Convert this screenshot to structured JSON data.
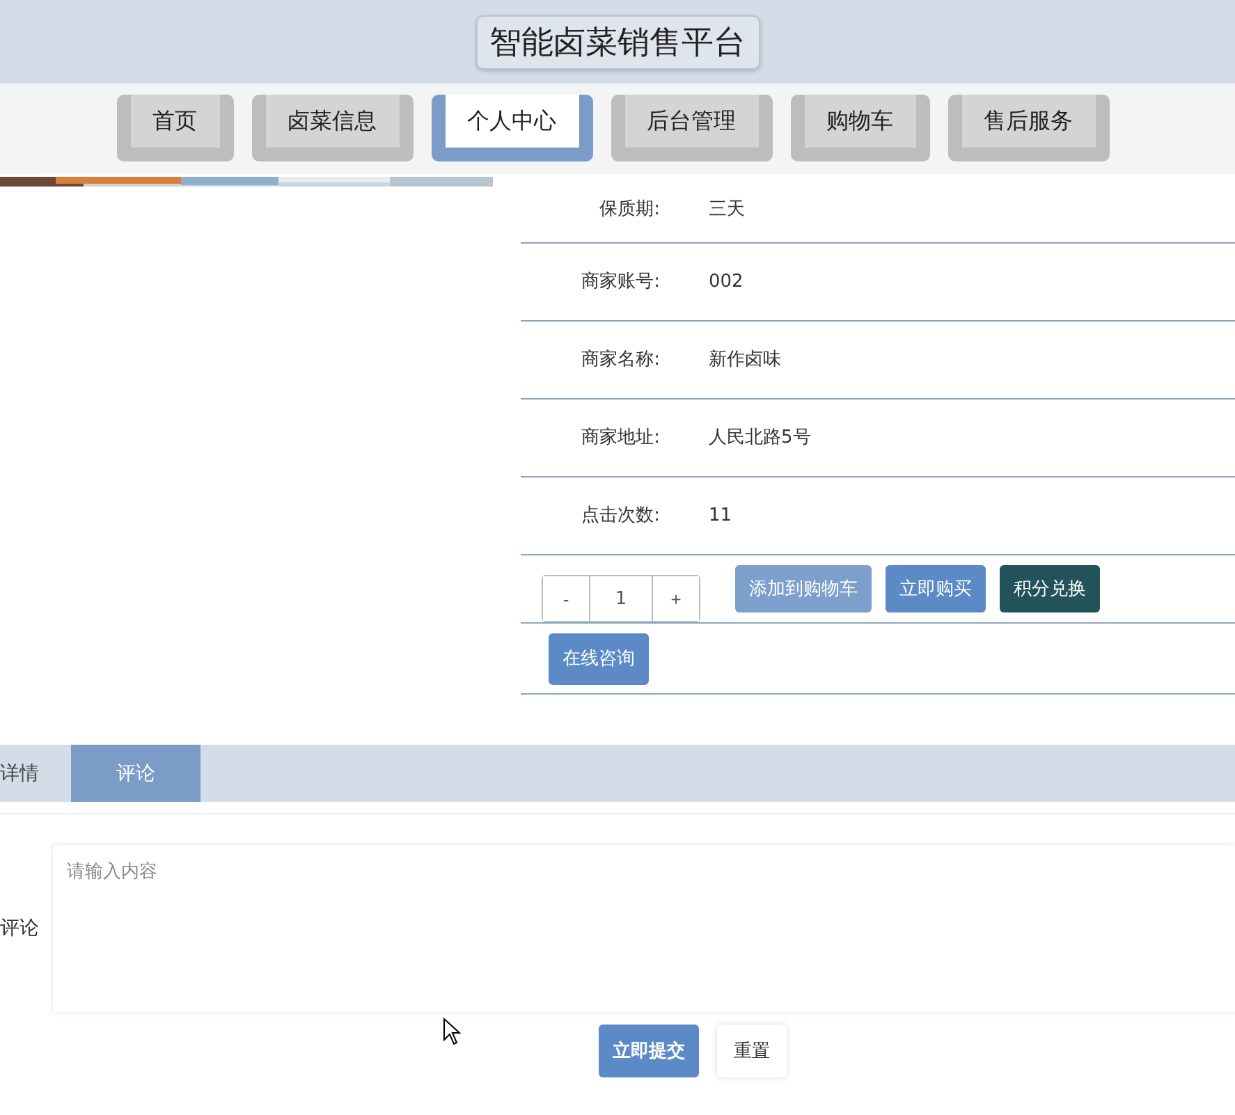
{
  "header": {
    "title": "智能卤菜销售平台"
  },
  "nav": [
    {
      "label": "首页",
      "selected": false
    },
    {
      "label": "卤菜信息",
      "selected": false
    },
    {
      "label": "个人中心",
      "selected": true
    },
    {
      "label": "后台管理",
      "selected": false
    },
    {
      "label": "购物车",
      "selected": false
    },
    {
      "label": "售后服务",
      "selected": false
    }
  ],
  "product": {
    "details": [
      {
        "label": "保质期:",
        "value": "三天"
      },
      {
        "label": "商家账号:",
        "value": "002"
      },
      {
        "label": "商家名称:",
        "value": "新作卤味"
      },
      {
        "label": "商家地址:",
        "value": "人民北路5号"
      },
      {
        "label": "点击次数:",
        "value": "11"
      }
    ],
    "quantity": {
      "minus": "-",
      "value": "1",
      "plus": "+"
    },
    "actions": [
      {
        "label": "添加到购物车",
        "kind": "primary",
        "disabled": true
      },
      {
        "label": "立即购买",
        "kind": "primary",
        "disabled": false
      },
      {
        "label": "积分兑换",
        "kind": "dark",
        "disabled": false
      }
    ],
    "consult": "在线咨询"
  },
  "tabs": [
    {
      "label": "详情",
      "selected": false
    },
    {
      "label": "评论",
      "selected": true
    }
  ],
  "comment_form": {
    "label": "评论",
    "placeholder": "请输入内容",
    "submit": "立即提交",
    "reset": "重置"
  }
}
